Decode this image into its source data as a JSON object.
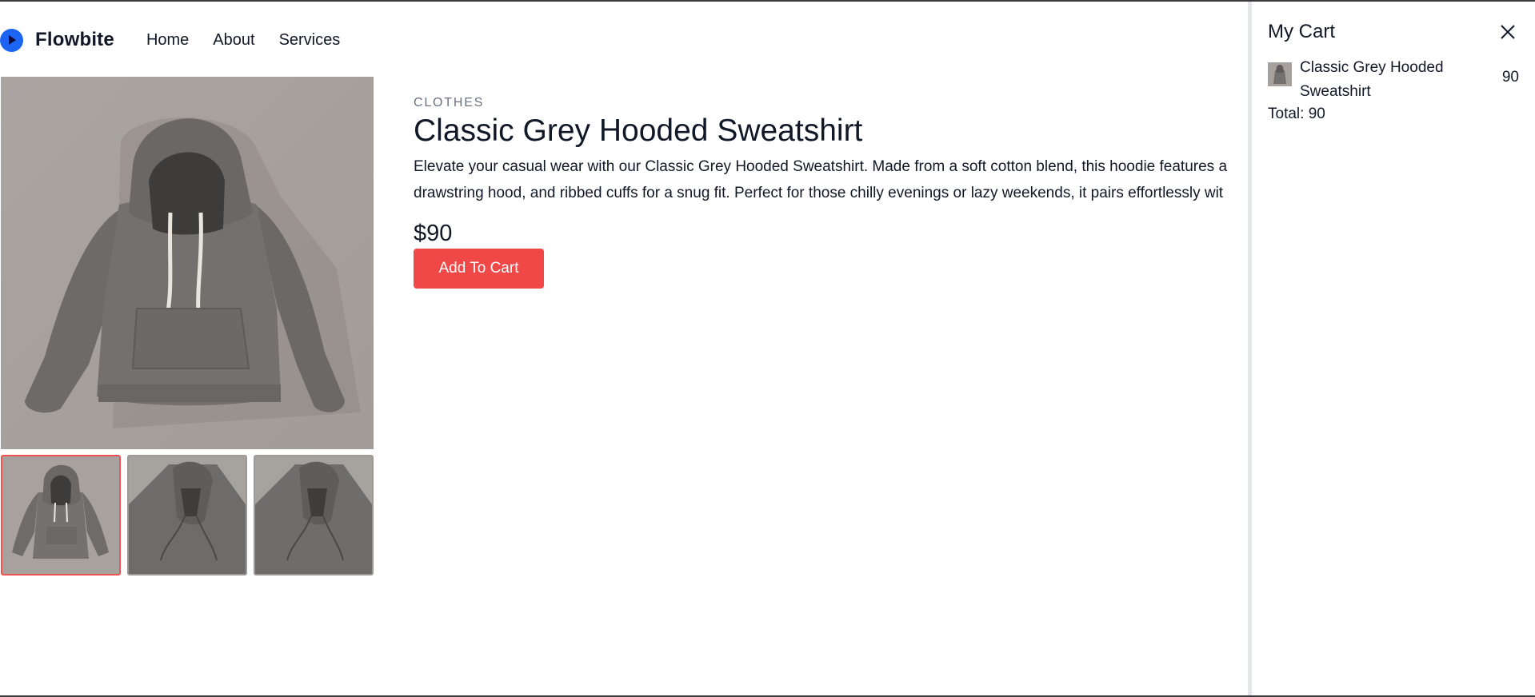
{
  "navbar": {
    "brand": "Flowbite",
    "links": [
      {
        "label": "Home"
      },
      {
        "label": "About"
      },
      {
        "label": "Services"
      }
    ]
  },
  "product": {
    "category": "Clothes",
    "title": "Classic Grey Hooded Sweatshirt",
    "description_line1": "Elevate your casual wear with our Classic Grey Hooded Sweatshirt. Made from a soft cotton blend, this hoodie features a",
    "description_line2": "drawstring hood, and ribbed cuffs for a snug fit. Perfect for those chilly evenings or lazy weekends, it pairs effortlessly wit",
    "price": "$90",
    "add_to_cart_label": "Add To Cart",
    "thumbnails": [
      {
        "view": "front",
        "active": true
      },
      {
        "view": "detail",
        "active": false
      },
      {
        "view": "detail",
        "active": false
      }
    ]
  },
  "cart": {
    "title": "My Cart",
    "items": [
      {
        "name": "Classic Grey Hooded Sweatshirt",
        "quantity": "90"
      }
    ],
    "total": "Total: 90"
  },
  "colors": {
    "accent": "#f04747",
    "brand": "#1c64f2",
    "active_thumb_border": "#f05252"
  }
}
